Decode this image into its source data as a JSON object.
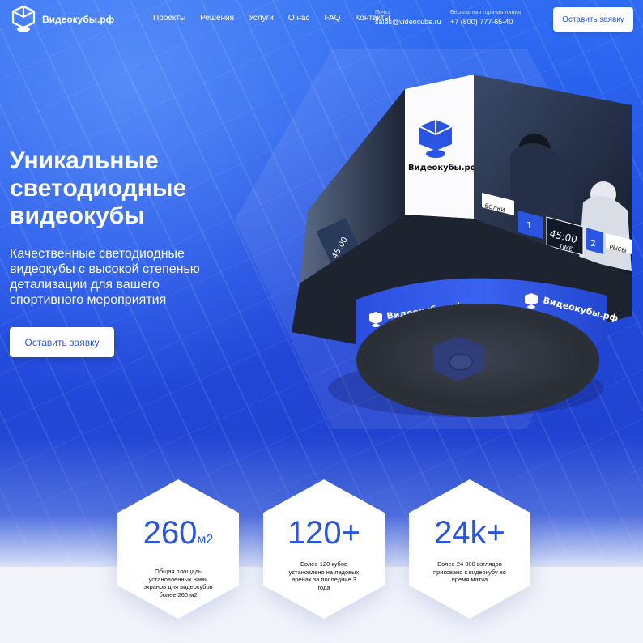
{
  "header": {
    "brand": "Видеокубы.рф",
    "nav": [
      "Проекты",
      "Решения",
      "Услуги",
      "О нас",
      "FAQ",
      "Контакты"
    ],
    "email_label": "Почта",
    "email": "sales@videocube.ru",
    "phone_label": "Бесплатная горячая линия",
    "phone": "+7 (800) 777-65-40",
    "cta": "Оставить заявку"
  },
  "hero": {
    "title_line1": "Уникальные",
    "title_line2": "светодиодные",
    "title_line3": "видеокубы",
    "subtitle": "Качественные светодиодные видеокубы с высокой степенью детализации для вашего спортивного мероприятия",
    "cta": "Оставить заявку"
  },
  "cube": {
    "brand": "Видеокубы.рф",
    "team_left": "ВОЛКИ",
    "team_right": "РЫСЫ",
    "score_left": "1",
    "score_right": "2",
    "clock": "45:00",
    "clock_label": "TIME"
  },
  "stats": [
    {
      "value": "260",
      "unit": "м2",
      "desc": "Общая площадь установленных нами экранов для видеокубов более 260 м2"
    },
    {
      "value": "120+",
      "unit": "",
      "desc": "Более 120 кубов установлено на ледовых аренах за последние 3 года"
    },
    {
      "value": "24k+",
      "unit": "",
      "desc": "Более 24 000 взглядов приковано к видеокубу во время матча"
    }
  ],
  "colors": {
    "accent": "#2a55e0",
    "hero_bg": "#2353e8",
    "white": "#ffffff"
  }
}
